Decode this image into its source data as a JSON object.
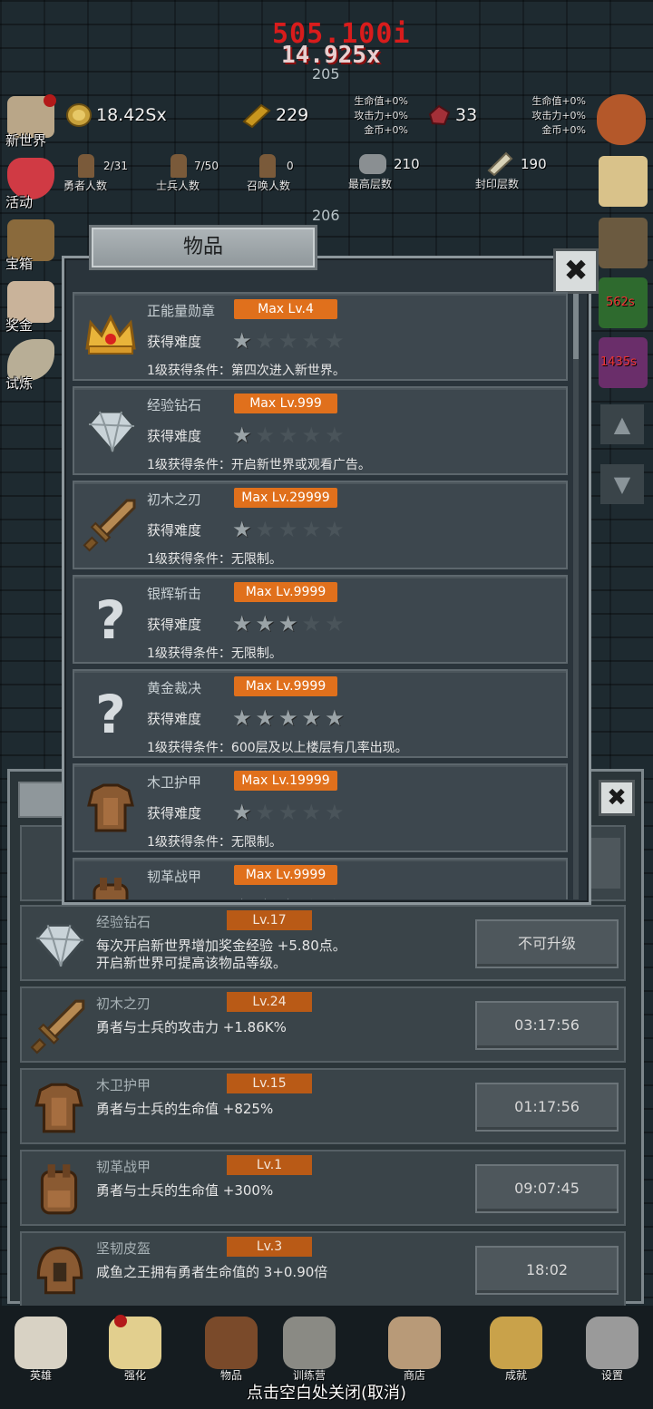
{
  "hud": {
    "damage_total": "505.100i",
    "damage_hit": "14.925x",
    "floor_top": "205",
    "floor_mid": "206",
    "gold": "18.42Sx",
    "bread": "229",
    "gem": "33",
    "buff_left": [
      "生命值+0%",
      "攻击力+0%",
      "金币+0%"
    ],
    "buff_right": [
      "生命值+0%",
      "攻击力+0%",
      "金币+0%"
    ],
    "stats": [
      {
        "value": "2/31",
        "label": "勇者人数"
      },
      {
        "value": "7/50",
        "label": "士兵人数"
      },
      {
        "value": "0",
        "label": "召唤人数"
      },
      {
        "value": "210",
        "label": "最高层数"
      },
      {
        "value": "190",
        "label": "封印层数"
      }
    ],
    "right_timers": [
      "562s",
      "1435s"
    ]
  },
  "left_menu": [
    "新世界",
    "活动",
    "宝箱",
    "奖金",
    "试炼"
  ],
  "modal": {
    "title": "物品",
    "close": "✖",
    "difficulty_label": "获得难度",
    "items": [
      {
        "name": "正能量勋章",
        "max": "Max Lv.4",
        "stars": 1,
        "cond": "1级获得条件：第四次进入新世界。",
        "icon": "crown-icon"
      },
      {
        "name": "经验钻石",
        "max": "Max Lv.999",
        "stars": 1,
        "cond": "1级获得条件：开启新世界或观看广告。",
        "icon": "diamond-icon"
      },
      {
        "name": "初木之刃",
        "max": "Max Lv.29999",
        "stars": 1,
        "cond": "1级获得条件：无限制。",
        "icon": "sword-icon"
      },
      {
        "name": "银辉斩击",
        "max": "Max Lv.9999",
        "stars": 3,
        "cond": "1级获得条件：无限制。",
        "icon": "unknown-icon"
      },
      {
        "name": "黄金裁决",
        "max": "Max Lv.9999",
        "stars": 5,
        "cond": "1级获得条件：600层及以上楼层有几率出现。",
        "icon": "unknown-icon"
      },
      {
        "name": "木卫护甲",
        "max": "Max Lv.19999",
        "stars": 1,
        "cond": "1级获得条件：无限制。",
        "icon": "armor-icon"
      },
      {
        "name": "韧革战甲",
        "max": "Max Lv.9999",
        "stars": 3,
        "cond": "",
        "icon": "backpack-icon"
      }
    ]
  },
  "lower": {
    "rows": [
      {
        "name": "经验钻石",
        "lv": "Lv.17",
        "desc": [
          "每次开启新世界增加奖金经验 +5.80点。",
          "开启新世界可提高该物品等级。"
        ],
        "btn": "不可升级",
        "icon": "diamond-icon"
      },
      {
        "name": "初木之刃",
        "lv": "Lv.24",
        "desc": [
          "勇者与士兵的攻击力 +1.86K%"
        ],
        "btn": "03:17:56",
        "icon": "sword-icon"
      },
      {
        "name": "木卫护甲",
        "lv": "Lv.15",
        "desc": [
          "勇者与士兵的生命值 +825%"
        ],
        "btn": "01:17:56",
        "icon": "armor-icon"
      },
      {
        "name": "韧革战甲",
        "lv": "Lv.1",
        "desc": [
          "勇者与士兵的生命值 +300%"
        ],
        "btn": "09:07:45",
        "icon": "backpack-icon"
      },
      {
        "name": "坚韧皮盔",
        "lv": "Lv.3",
        "desc": [
          "咸鱼之王拥有勇者生命值的 3+0.90倍"
        ],
        "btn": "18:02",
        "icon": "helmet-icon"
      }
    ]
  },
  "nav": [
    "英雄",
    "强化",
    "物品",
    "训练营",
    "商店",
    "成就",
    "设置"
  ],
  "close_hint": "点击空白处关闭(取消)",
  "colors": {
    "badge_orange": "#e0701c",
    "damage_red": "#d81c1c",
    "panel": "#2a343b"
  }
}
